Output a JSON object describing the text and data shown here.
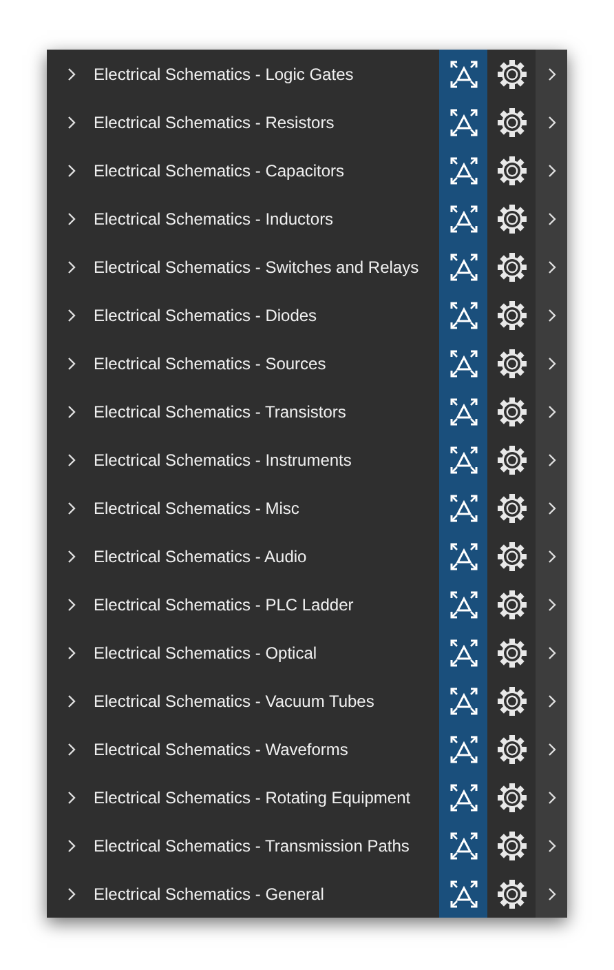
{
  "items": [
    {
      "label": "Electrical Schematics - Logic Gates",
      "expanded": false
    },
    {
      "label": "Electrical Schematics - Resistors",
      "expanded": false
    },
    {
      "label": "Electrical Schematics - Capacitors",
      "expanded": false
    },
    {
      "label": "Electrical Schematics - Inductors",
      "expanded": false
    },
    {
      "label": "Electrical Schematics - Switches and Relays",
      "expanded": false
    },
    {
      "label": "Electrical Schematics - Diodes",
      "expanded": false
    },
    {
      "label": "Electrical Schematics - Sources",
      "expanded": false
    },
    {
      "label": "Electrical Schematics - Transistors",
      "expanded": false
    },
    {
      "label": "Electrical Schematics - Instruments",
      "expanded": false
    },
    {
      "label": "Electrical Schematics - Misc",
      "expanded": false
    },
    {
      "label": "Electrical Schematics - Audio",
      "expanded": false
    },
    {
      "label": "Electrical Schematics - PLC Ladder",
      "expanded": false
    },
    {
      "label": "Electrical Schematics - Optical",
      "expanded": false
    },
    {
      "label": "Electrical Schematics - Vacuum Tubes",
      "expanded": false
    },
    {
      "label": "Electrical Schematics - Waveforms",
      "expanded": false
    },
    {
      "label": "Electrical Schematics - Rotating Equipment",
      "expanded": false
    },
    {
      "label": "Electrical Schematics - Transmission Paths",
      "expanded": false
    },
    {
      "label": "Electrical Schematics - General",
      "expanded": false
    }
  ]
}
